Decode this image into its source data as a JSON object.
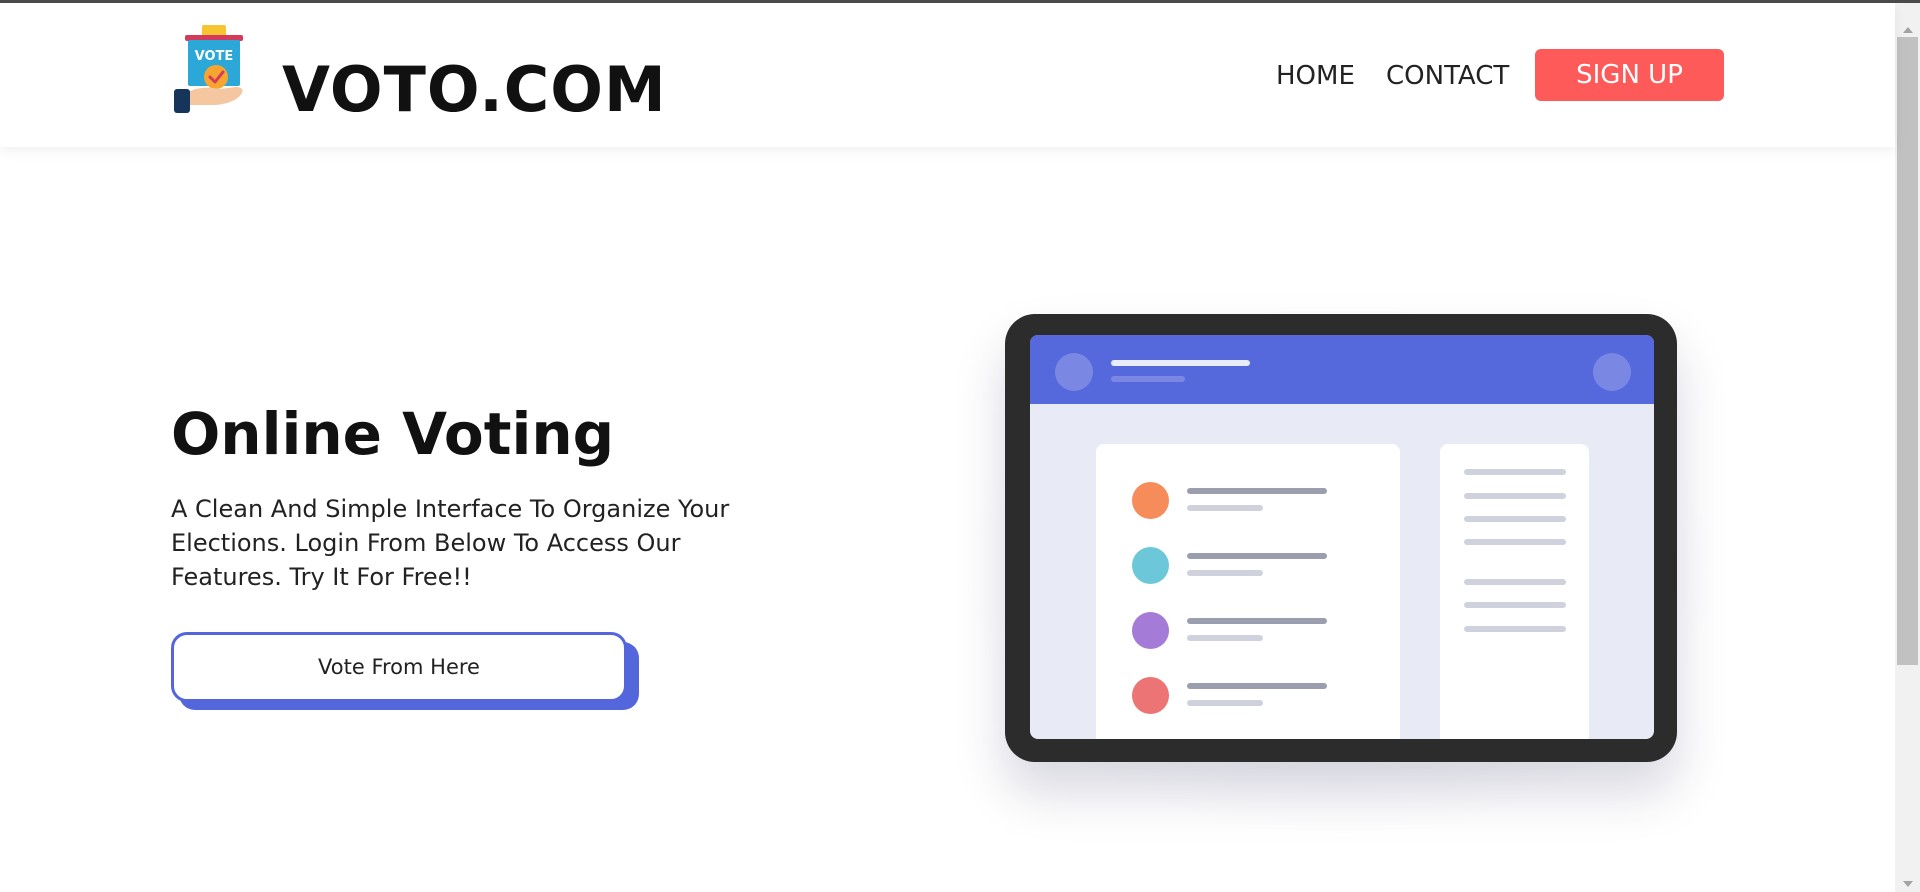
{
  "brand": {
    "name": "VOTO.COM",
    "logo_text": "VOTE",
    "logo_icon": "ballot-box-hand-icon"
  },
  "nav": {
    "home": "HOME",
    "contact": "CONTACT",
    "signup": "SIGN UP"
  },
  "hero": {
    "title": "Online Voting",
    "description": "A Clean And Simple Interface To Organize Your Elections. Login From Below To Access Our Features. Try It For Free!!",
    "cta_label": "Vote From Here"
  },
  "illustration": {
    "icon": "tablet-dashboard-illustration",
    "list_dot_colors": [
      "#f68c5a",
      "#6cc8d8",
      "#a47cd8",
      "#ec7474"
    ]
  },
  "colors": {
    "accent": "#5568dc",
    "signup": "#ff5a5a"
  }
}
